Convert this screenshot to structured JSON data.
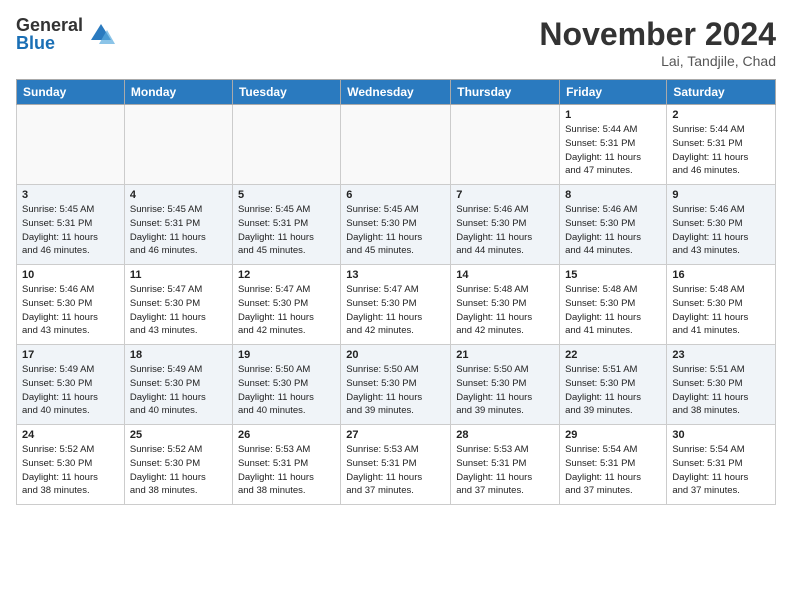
{
  "header": {
    "logo_general": "General",
    "logo_blue": "Blue",
    "title": "November 2024",
    "location": "Lai, Tandjile, Chad"
  },
  "weekdays": [
    "Sunday",
    "Monday",
    "Tuesday",
    "Wednesday",
    "Thursday",
    "Friday",
    "Saturday"
  ],
  "weeks": [
    [
      {
        "day": "",
        "info": ""
      },
      {
        "day": "",
        "info": ""
      },
      {
        "day": "",
        "info": ""
      },
      {
        "day": "",
        "info": ""
      },
      {
        "day": "",
        "info": ""
      },
      {
        "day": "1",
        "info": "Sunrise: 5:44 AM\nSunset: 5:31 PM\nDaylight: 11 hours\nand 47 minutes."
      },
      {
        "day": "2",
        "info": "Sunrise: 5:44 AM\nSunset: 5:31 PM\nDaylight: 11 hours\nand 46 minutes."
      }
    ],
    [
      {
        "day": "3",
        "info": "Sunrise: 5:45 AM\nSunset: 5:31 PM\nDaylight: 11 hours\nand 46 minutes."
      },
      {
        "day": "4",
        "info": "Sunrise: 5:45 AM\nSunset: 5:31 PM\nDaylight: 11 hours\nand 46 minutes."
      },
      {
        "day": "5",
        "info": "Sunrise: 5:45 AM\nSunset: 5:31 PM\nDaylight: 11 hours\nand 45 minutes."
      },
      {
        "day": "6",
        "info": "Sunrise: 5:45 AM\nSunset: 5:30 PM\nDaylight: 11 hours\nand 45 minutes."
      },
      {
        "day": "7",
        "info": "Sunrise: 5:46 AM\nSunset: 5:30 PM\nDaylight: 11 hours\nand 44 minutes."
      },
      {
        "day": "8",
        "info": "Sunrise: 5:46 AM\nSunset: 5:30 PM\nDaylight: 11 hours\nand 44 minutes."
      },
      {
        "day": "9",
        "info": "Sunrise: 5:46 AM\nSunset: 5:30 PM\nDaylight: 11 hours\nand 43 minutes."
      }
    ],
    [
      {
        "day": "10",
        "info": "Sunrise: 5:46 AM\nSunset: 5:30 PM\nDaylight: 11 hours\nand 43 minutes."
      },
      {
        "day": "11",
        "info": "Sunrise: 5:47 AM\nSunset: 5:30 PM\nDaylight: 11 hours\nand 43 minutes."
      },
      {
        "day": "12",
        "info": "Sunrise: 5:47 AM\nSunset: 5:30 PM\nDaylight: 11 hours\nand 42 minutes."
      },
      {
        "day": "13",
        "info": "Sunrise: 5:47 AM\nSunset: 5:30 PM\nDaylight: 11 hours\nand 42 minutes."
      },
      {
        "day": "14",
        "info": "Sunrise: 5:48 AM\nSunset: 5:30 PM\nDaylight: 11 hours\nand 42 minutes."
      },
      {
        "day": "15",
        "info": "Sunrise: 5:48 AM\nSunset: 5:30 PM\nDaylight: 11 hours\nand 41 minutes."
      },
      {
        "day": "16",
        "info": "Sunrise: 5:48 AM\nSunset: 5:30 PM\nDaylight: 11 hours\nand 41 minutes."
      }
    ],
    [
      {
        "day": "17",
        "info": "Sunrise: 5:49 AM\nSunset: 5:30 PM\nDaylight: 11 hours\nand 40 minutes."
      },
      {
        "day": "18",
        "info": "Sunrise: 5:49 AM\nSunset: 5:30 PM\nDaylight: 11 hours\nand 40 minutes."
      },
      {
        "day": "19",
        "info": "Sunrise: 5:50 AM\nSunset: 5:30 PM\nDaylight: 11 hours\nand 40 minutes."
      },
      {
        "day": "20",
        "info": "Sunrise: 5:50 AM\nSunset: 5:30 PM\nDaylight: 11 hours\nand 39 minutes."
      },
      {
        "day": "21",
        "info": "Sunrise: 5:50 AM\nSunset: 5:30 PM\nDaylight: 11 hours\nand 39 minutes."
      },
      {
        "day": "22",
        "info": "Sunrise: 5:51 AM\nSunset: 5:30 PM\nDaylight: 11 hours\nand 39 minutes."
      },
      {
        "day": "23",
        "info": "Sunrise: 5:51 AM\nSunset: 5:30 PM\nDaylight: 11 hours\nand 38 minutes."
      }
    ],
    [
      {
        "day": "24",
        "info": "Sunrise: 5:52 AM\nSunset: 5:30 PM\nDaylight: 11 hours\nand 38 minutes."
      },
      {
        "day": "25",
        "info": "Sunrise: 5:52 AM\nSunset: 5:30 PM\nDaylight: 11 hours\nand 38 minutes."
      },
      {
        "day": "26",
        "info": "Sunrise: 5:53 AM\nSunset: 5:31 PM\nDaylight: 11 hours\nand 38 minutes."
      },
      {
        "day": "27",
        "info": "Sunrise: 5:53 AM\nSunset: 5:31 PM\nDaylight: 11 hours\nand 37 minutes."
      },
      {
        "day": "28",
        "info": "Sunrise: 5:53 AM\nSunset: 5:31 PM\nDaylight: 11 hours\nand 37 minutes."
      },
      {
        "day": "29",
        "info": "Sunrise: 5:54 AM\nSunset: 5:31 PM\nDaylight: 11 hours\nand 37 minutes."
      },
      {
        "day": "30",
        "info": "Sunrise: 5:54 AM\nSunset: 5:31 PM\nDaylight: 11 hours\nand 37 minutes."
      }
    ]
  ]
}
